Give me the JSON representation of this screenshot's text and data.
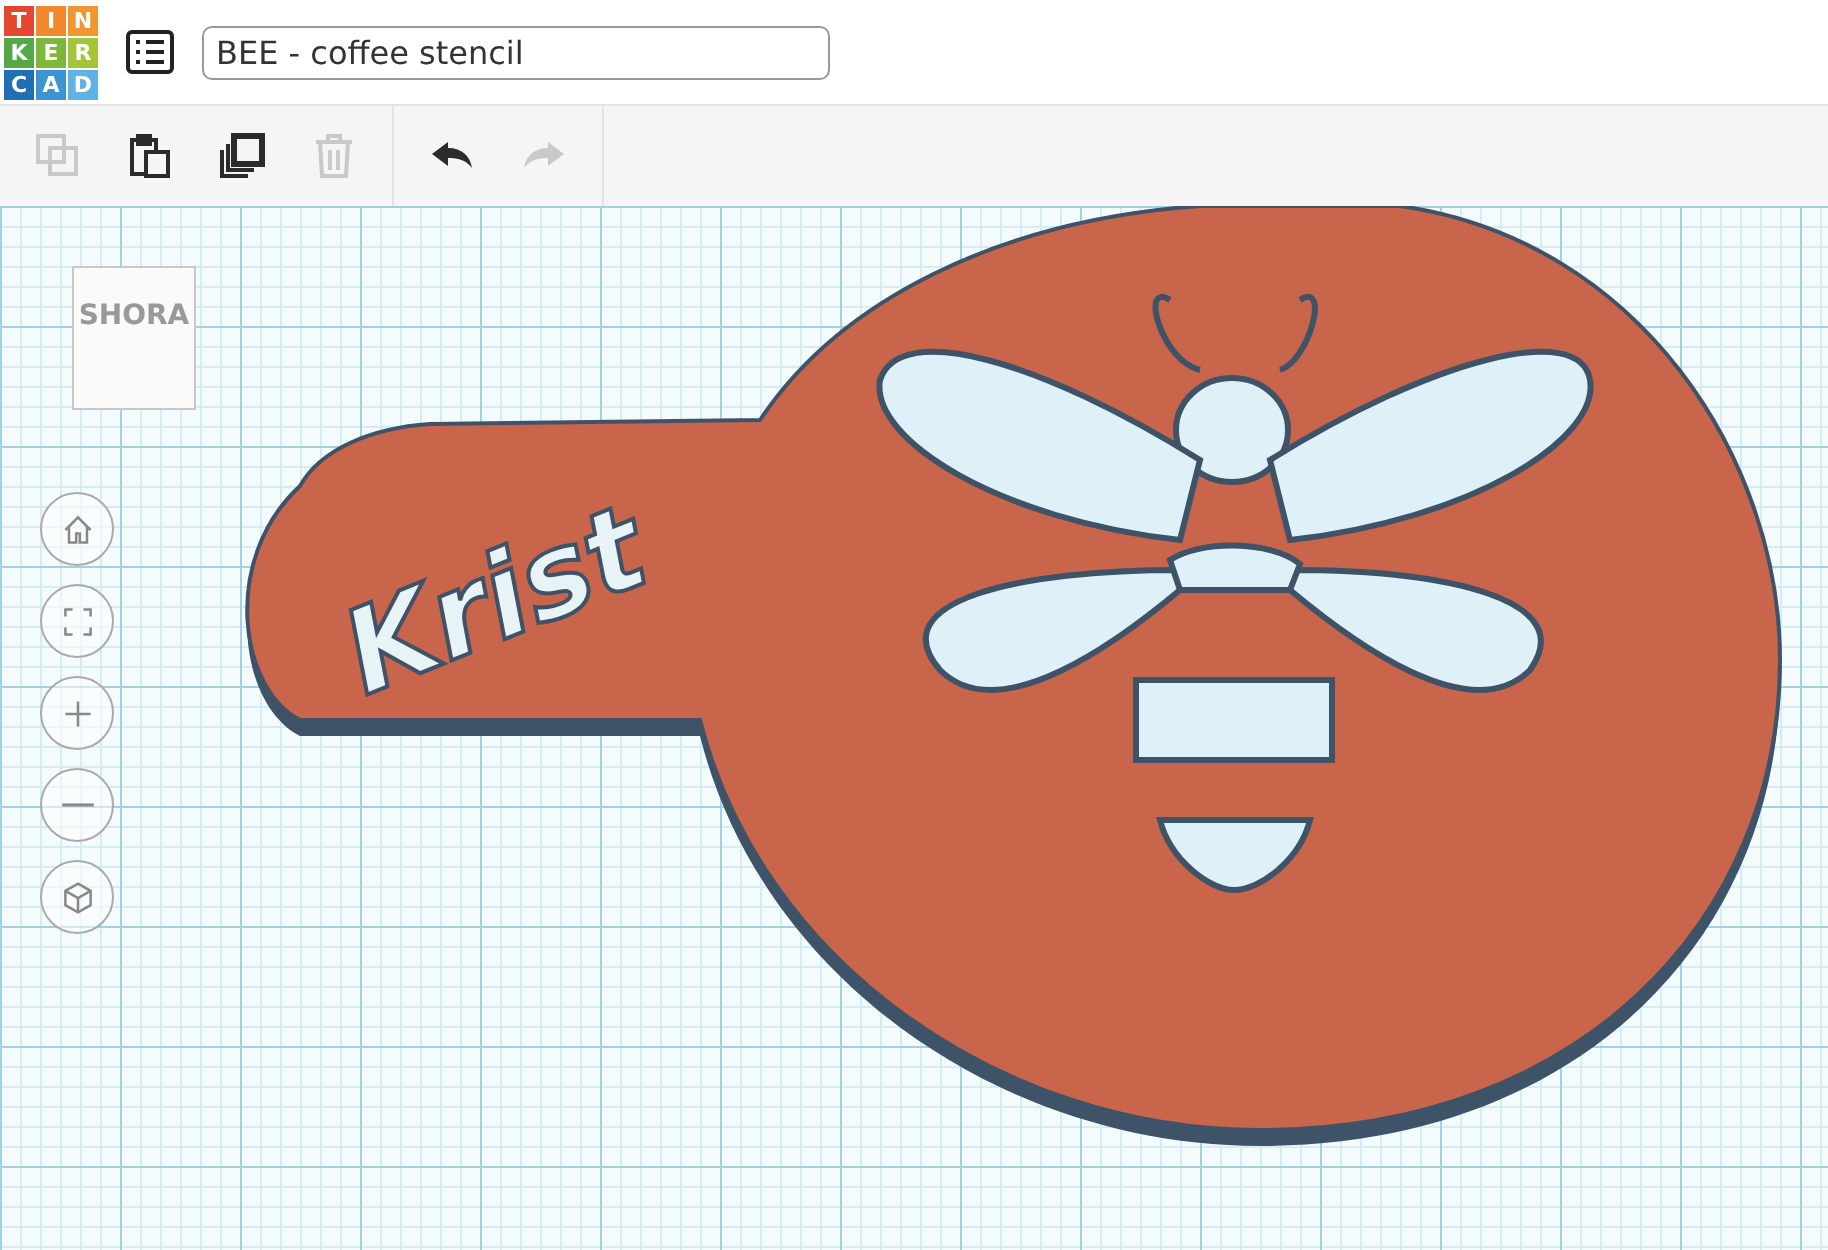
{
  "logo": {
    "letters": [
      {
        "char": "T",
        "color": "#e4472f"
      },
      {
        "char": "I",
        "color": "#f08a2c"
      },
      {
        "char": "N",
        "color": "#f0962e"
      },
      {
        "char": "K",
        "color": "#55a845"
      },
      {
        "char": "E",
        "color": "#7db83b"
      },
      {
        "char": "R",
        "color": "#a2c53a"
      },
      {
        "char": "C",
        "color": "#1f6fb5"
      },
      {
        "char": "A",
        "color": "#3b95d3"
      },
      {
        "char": "D",
        "color": "#5fb2e3"
      }
    ]
  },
  "design_title": "BEE - coffee stencil",
  "toolbar": [
    {
      "kind": "copy",
      "disabled": true
    },
    {
      "kind": "paste",
      "disabled": false
    },
    {
      "kind": "duplicate",
      "disabled": false
    },
    {
      "kind": "delete",
      "disabled": true
    },
    {
      "kind": "undo",
      "disabled": false
    },
    {
      "kind": "redo",
      "disabled": true
    }
  ],
  "view_cube": {
    "face": "SHORA"
  },
  "nav_controls": [
    {
      "kind": "home"
    },
    {
      "kind": "fit"
    },
    {
      "kind": "zoom-in"
    },
    {
      "kind": "zoom-out"
    },
    {
      "kind": "perspective"
    }
  ],
  "model": {
    "engraving": "Krist"
  }
}
